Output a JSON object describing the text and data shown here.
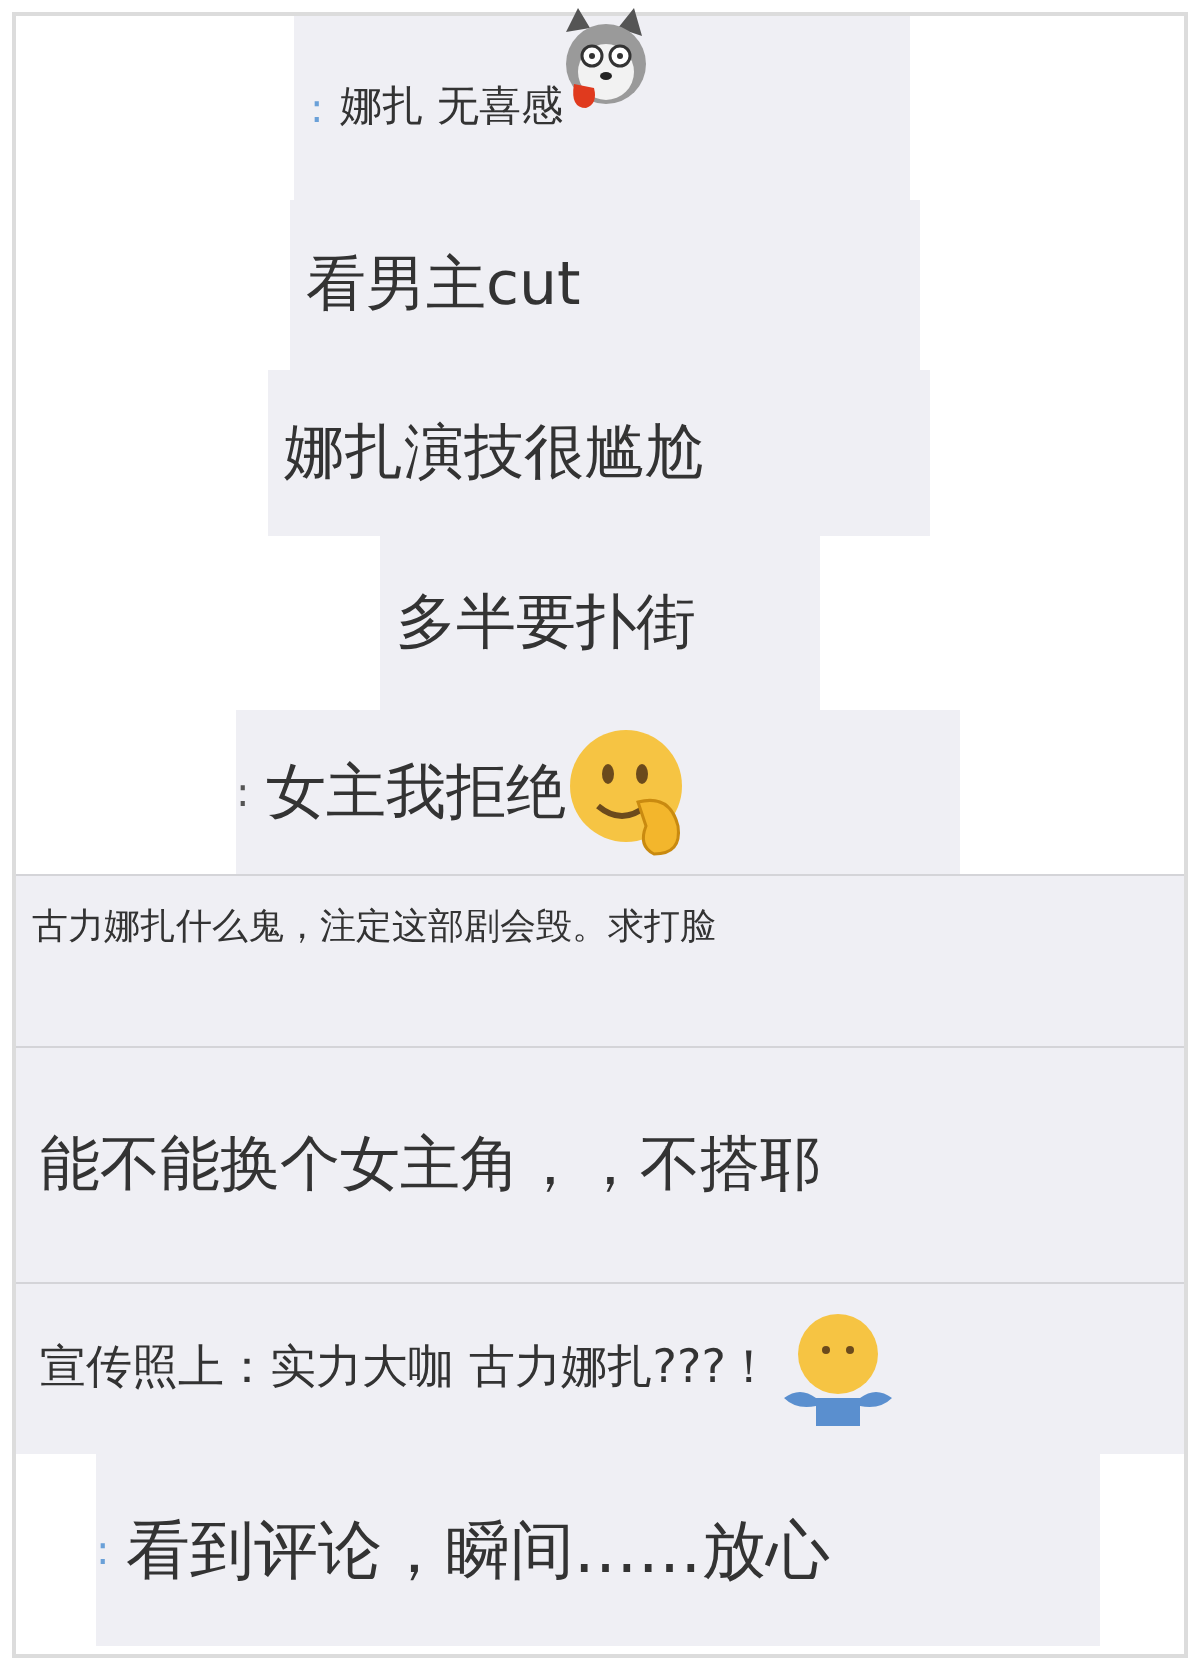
{
  "comments": [
    {
      "kind": "emoji",
      "prefix": ":",
      "text": "娜扎 无喜感"
    },
    {
      "kind": "text",
      "text": "看男主cut"
    },
    {
      "kind": "text",
      "text": "娜扎演技很尴尬"
    },
    {
      "kind": "text",
      "text": "多半要扑街"
    },
    {
      "kind": "emoji",
      "prefix": ":",
      "text": "女主我拒绝"
    },
    {
      "kind": "text",
      "text": "古力娜扎什么鬼，注定这部剧会毁。求打脸"
    },
    {
      "kind": "text",
      "text": "能不能换个女主角，，不搭耶"
    },
    {
      "kind": "emoji",
      "text": "宣传照上：实力大咖 古力娜扎???！"
    },
    {
      "kind": "text",
      "prefix": ":",
      "text": "看到评论，瞬间……放心"
    }
  ]
}
